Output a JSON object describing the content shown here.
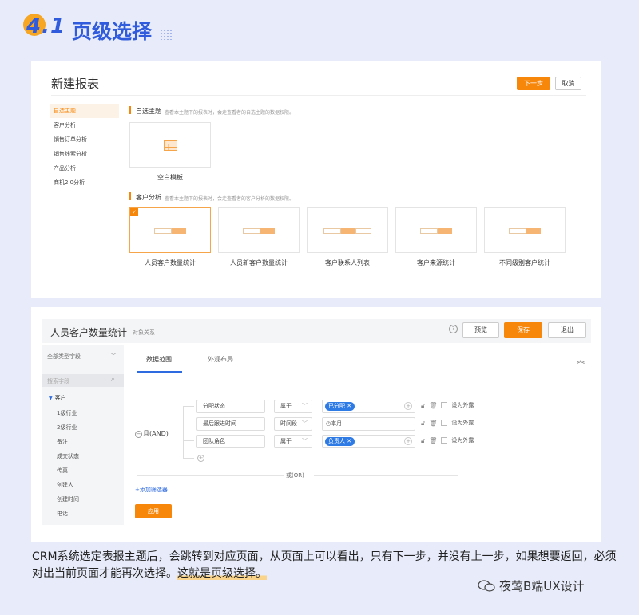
{
  "heading": {
    "number": "4.1",
    "title": "页级选择"
  },
  "panel1": {
    "title": "新建报表",
    "next_button": "下一步",
    "cancel_button": "取消",
    "sidebar": [
      "自选主题",
      "客户分析",
      "销售订单分析",
      "销售线索分析",
      "产品分析",
      "商机2.0分析"
    ],
    "sections": [
      {
        "title": "自选主题",
        "desc": "查看本主题下的报表时，会走查看者的自选主题的数据权限。"
      },
      {
        "title": "客户分析",
        "desc": "查看本主题下的报表时，会走查看者的客户分析的数据权限。"
      }
    ],
    "blank_template": "空白模板",
    "templates": [
      "人员客户数量统计",
      "人员新客户数量统计",
      "客户联系人列表",
      "客户来源统计",
      "不同级别客户统计"
    ]
  },
  "panel2": {
    "title": "人员客户数量统计",
    "subtitle": "对象关系",
    "preview_button": "预览",
    "save_button": "保存",
    "exit_button": "退出",
    "field_type_select": "全部类型字段",
    "search_placeholder": "搜索字段",
    "group": "客户",
    "fields": [
      "1级行业",
      "2级行业",
      "备注",
      "成交状态",
      "传真",
      "创建人",
      "创建时间",
      "电话"
    ],
    "tabs": [
      "数据范围",
      "外观布局"
    ],
    "and_label": "且(AND)",
    "or_label": "或(OR)",
    "rows": [
      {
        "field": "分配状态",
        "op": "属于",
        "value": "已分配",
        "expose": "设为外露"
      },
      {
        "field": "最后跟进时间",
        "op": "时间段",
        "value": "本月",
        "expose": "设为外露"
      },
      {
        "field": "团队角色",
        "op": "属于",
        "value": "负责人",
        "expose": "设为外露"
      }
    ],
    "add_filter": "+添加筛选器",
    "apply_button": "应用"
  },
  "caption": {
    "line1": "CRM系统选定表报主题后，会跳转到对应页面，从页面上可以看出，只有下一步，并没有上一步，如果想要返回，必须",
    "line2_plain": "对出当前页面才能再次选择。",
    "line2_hl": "这就是页级选择。"
  },
  "watermark": "夜莺B端UX设计",
  "colors": {
    "accent": "#f7870b",
    "heading_blue": "#2f5bdc",
    "tag_blue": "#2f7be6"
  }
}
